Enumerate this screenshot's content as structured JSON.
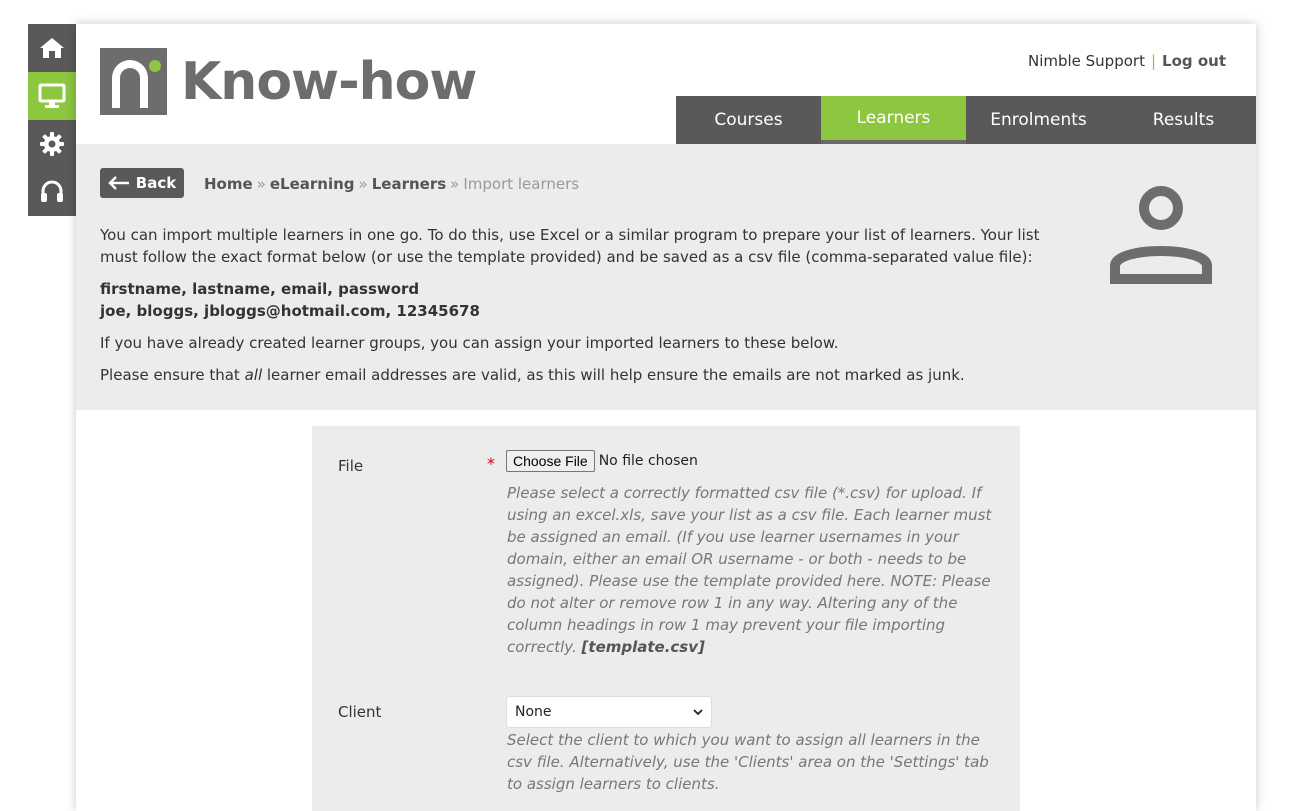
{
  "rail": {
    "items": [
      {
        "icon": "home-icon",
        "active": false
      },
      {
        "icon": "monitor-icon",
        "active": true
      },
      {
        "icon": "gear-icon",
        "active": false
      },
      {
        "icon": "headset-icon",
        "active": false
      }
    ]
  },
  "brand": {
    "name": "Know-how",
    "accent": "#8dc63f",
    "dark": "#595959"
  },
  "user": {
    "name": "Nimble Support",
    "separator": "|",
    "logout_label": "Log out"
  },
  "nav": {
    "tabs": [
      {
        "label": "Courses",
        "active": false
      },
      {
        "label": "Learners",
        "active": true
      },
      {
        "label": "Enrolments",
        "active": false
      },
      {
        "label": "Results",
        "active": false
      }
    ]
  },
  "back_label": "Back",
  "breadcrumb": {
    "home": "Home",
    "elearning": "eLearning",
    "learners": "Learners",
    "current": "Import learners",
    "sep": "»"
  },
  "intro": {
    "p1": "You can import multiple learners in one go. To do this, use Excel or a similar program to prepare your list of learners. Your list must follow the exact format below (or use the template provided) and be saved as a csv file (comma-separated value file):",
    "format_line1": "firstname, lastname, email, password",
    "format_line2": "joe, bloggs, jbloggs@hotmail.com, 12345678",
    "p2": "If you have already created learner groups, you can assign your imported learners to these below.",
    "p3_before": "Please ensure that ",
    "p3_em": "all",
    "p3_after": " learner email addresses are valid, as this will help ensure the emails are not marked as junk."
  },
  "form": {
    "file_label": "File",
    "required_mark": "*",
    "choose_file_label": "Choose File",
    "no_file_text": "No file chosen",
    "file_help": "Please select a correctly formatted csv file (*.csv) for upload. If using an excel.xls, save your list as a csv file. Each learner must be assigned an email. (If you use learner usernames in your domain, either an email OR username - or both - needs to be assigned). Please use the template provided here. NOTE: Please do not alter or remove row 1 in any way. Altering any of the column headings in row 1 may prevent your file importing correctly.",
    "template_link": "[template.csv]",
    "client_label": "Client",
    "client_selected": "None",
    "client_help": "Select the client to which you want to assign all learners in the csv file. Alternatively, use the 'Clients' area on the 'Settings' tab to assign learners to clients."
  }
}
